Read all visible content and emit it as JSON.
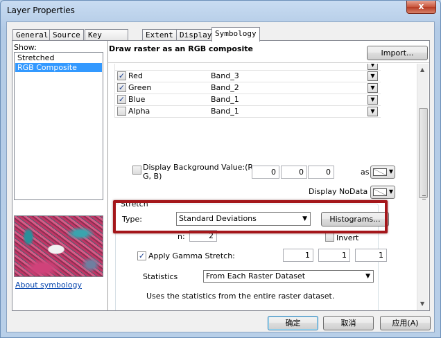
{
  "window": {
    "title": "Layer Properties",
    "close_glyph": "x"
  },
  "tabs": [
    {
      "label": "General",
      "active": false
    },
    {
      "label": "Source",
      "active": false
    },
    {
      "label": "Key Metadata",
      "active": false
    },
    {
      "label": "Extent",
      "active": false
    },
    {
      "label": "Display",
      "active": false
    },
    {
      "label": "Symbology",
      "active": true
    }
  ],
  "show": {
    "label": "Show:",
    "items": [
      {
        "label": "Stretched",
        "selected": false
      },
      {
        "label": "RGB Composite",
        "selected": true
      }
    ],
    "about_link": "About symbology"
  },
  "panel": {
    "title": "Draw raster as an RGB composite",
    "import_button": "Import..."
  },
  "bands": [
    {
      "channel": "Red",
      "checked": true,
      "band": "Band_3"
    },
    {
      "channel": "Green",
      "checked": true,
      "band": "Band_2"
    },
    {
      "channel": "Blue",
      "checked": true,
      "band": "Band_1"
    },
    {
      "channel": "Alpha",
      "checked": false,
      "band": "Band_1"
    }
  ],
  "background": {
    "label_line1": "Display Background Value:(R,",
    "label_line2": "G, B)",
    "checked": false,
    "values": [
      "0",
      "0",
      "0"
    ],
    "as_label": "as",
    "nodata_label": "Display NoData as"
  },
  "stretch": {
    "group_label": "Stretch",
    "type_label": "Type:",
    "type_value": "Standard Deviations",
    "histograms_button": "Histograms...",
    "n_label": "n:",
    "n_value": "2",
    "invert_label": "Invert",
    "invert_checked": false,
    "gamma_label": "Apply Gamma Stretch:",
    "gamma_checked": true,
    "gamma_values": [
      "1",
      "1",
      "1"
    ]
  },
  "statistics": {
    "label": "Statistics",
    "value": "From Each Raster Dataset",
    "description": "Uses the statistics from the entire raster dataset."
  },
  "footer": {
    "ok": "确定",
    "cancel": "取消",
    "apply": "应用(A)"
  },
  "colors": {
    "highlight": "#a4161a",
    "selection": "#3399ff",
    "link": "#0645ad"
  },
  "icons": {
    "checked_glyph": "✓",
    "dropdown_glyph": "▼",
    "scroll_up_glyph": "▲",
    "scroll_down_glyph": "▼"
  }
}
